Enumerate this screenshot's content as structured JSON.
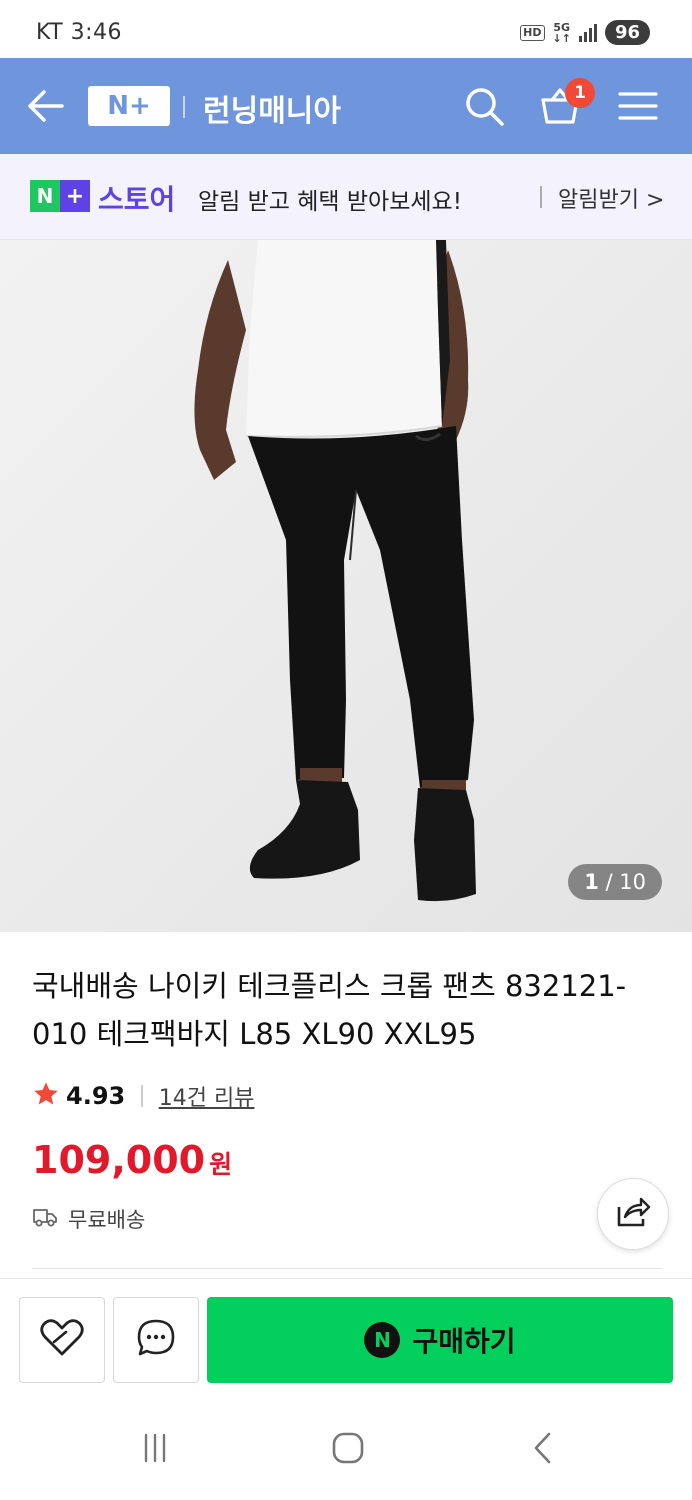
{
  "status_bar": {
    "carrier_time": "KT 3:46",
    "hd": "HD",
    "network": "5G",
    "battery": "96"
  },
  "header": {
    "logo": "N+",
    "store_name": "런닝매니아",
    "cart_count": "1",
    "bg_color": "#6f95dc"
  },
  "notice": {
    "logo_n": "N",
    "logo_plus": "+",
    "store_label": "스토어",
    "message": "알림 받고 혜택 받아보세요!",
    "link": "알림받기 >"
  },
  "image": {
    "current": "1",
    "total": "/ 10"
  },
  "product": {
    "title": "국내배송 나이키 테크플리스 크롭 팬츠 832121-010 테크팩바지 L85 XL90 XXL95",
    "rating": "4.93",
    "reviews": "14건 리뷰",
    "price": "109,000",
    "currency": "원",
    "shipping": "무료배송",
    "price_color": "#e1192a"
  },
  "actions": {
    "buy_label": "구매하기",
    "buy_icon": "N",
    "buy_color": "#03cf5d"
  },
  "icons": [
    "back-arrow-icon",
    "search-icon",
    "cart-icon",
    "menu-icon",
    "star-icon",
    "truck-icon",
    "share-icon",
    "heart-icon",
    "chat-icon",
    "recent-apps-icon",
    "home-icon",
    "back-icon"
  ]
}
